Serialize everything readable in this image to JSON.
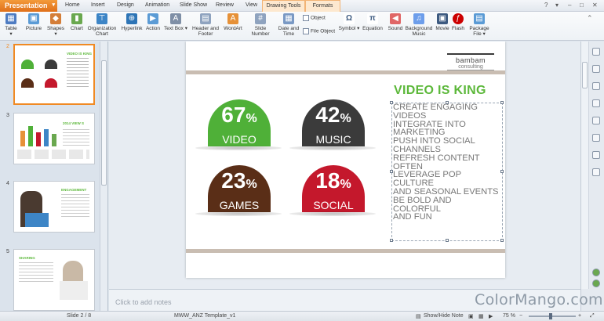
{
  "app_button": "Presentation",
  "menu": [
    "Home",
    "Insert",
    "Design",
    "Animation",
    "Slide Show",
    "Review",
    "View"
  ],
  "context_tabs": [
    "Drawing Tools",
    "Formats"
  ],
  "ribbon": {
    "table": "Table",
    "picture": "Picture",
    "shapes": "Shapes",
    "chart": "Chart",
    "org_chart_1": "Organization",
    "org_chart_2": "Chart",
    "hyperlink": "Hyperlink",
    "action": "Action",
    "text_box": "Text Box",
    "header_footer_1": "Header and",
    "header_footer_2": "Footer",
    "wordart": "WordArt",
    "slide_number": "Slide Number",
    "date_time_1": "Date and",
    "date_time_2": "Time",
    "object": "Object",
    "file_object": "File Object",
    "symbol": "Symbol",
    "equation": "Equation",
    "sound": "Sound",
    "bg_music_1": "Background",
    "bg_music_2": "Music",
    "movie": "Movie",
    "flash": "Flash",
    "package_file_1": "Package",
    "package_file_2": "File"
  },
  "thumbnails": [
    {
      "num": "2",
      "selected": true
    },
    {
      "num": "3",
      "selected": false
    },
    {
      "num": "4",
      "selected": false
    },
    {
      "num": "5",
      "selected": false
    }
  ],
  "thumb_text": {
    "t2_title": "VIDEO IS KING",
    "t3_title": "2014 VIEW S",
    "t4_title": "ENGAGEMENT",
    "t5_title": "SHARING"
  },
  "slide": {
    "logo_top": "bambam",
    "logo_bottom": "consulting",
    "title": "VIDEO IS KING",
    "stats": [
      {
        "value": "67",
        "unit": "%",
        "label": "VIDEO",
        "color": "#4fb038"
      },
      {
        "value": "42",
        "unit": "%",
        "label": "MUSIC",
        "color": "#3b3b3b"
      },
      {
        "value": "23",
        "unit": "%",
        "label": "GAMES",
        "color": "#5a2e17"
      },
      {
        "value": "18",
        "unit": "%",
        "label": "SOCIAL",
        "color": "#c4182c"
      }
    ],
    "body_lines": [
      "CREATE ENGAGING",
      "VIDEOS",
      "INTEGRATE INTO",
      "MARKETING",
      "PUSH INTO SOCIAL",
      "CHANNELS",
      "REFRESH CONTENT",
      "OFTEN",
      "LEVERAGE POP",
      "CULTURE",
      "AND SEASONAL EVENTS",
      "BE BOLD AND",
      "COLORFUL",
      "AND FUN"
    ]
  },
  "notes_placeholder": "Click to add notes",
  "status": {
    "slide_indicator": "Slide 2 / 8",
    "template": "MWW_ANZ Template_v1",
    "show_hide_note": "Show/Hide Note",
    "zoom": "75 %"
  },
  "watermark": "ColorMango.com",
  "colors": {
    "accent": "#f08a24",
    "title_green": "#5cb83a"
  }
}
